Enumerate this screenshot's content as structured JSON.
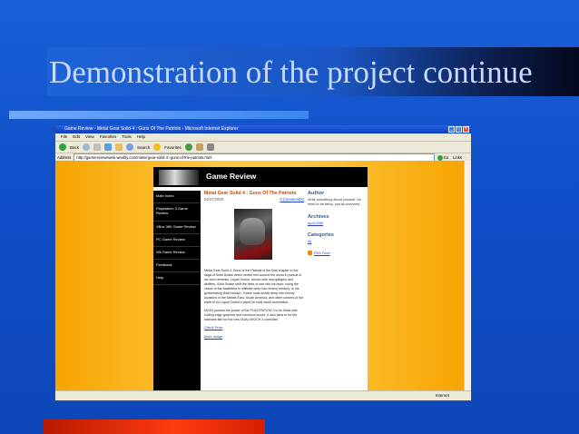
{
  "slide": {
    "title": "Demonstration of the project continue"
  },
  "browser": {
    "window_title": "Game Review - Metal Gear Solid 4 : Guns Of The Patriots - Microsoft Internet Explorer",
    "menu": [
      "File",
      "Edit",
      "View",
      "Favorites",
      "Tools",
      "Help"
    ],
    "toolbar": {
      "back": "Back",
      "search": "Search",
      "favorites": "Favorites"
    },
    "address_label": "Address",
    "address_value": "http://gamereviewsweb.weebly.com/metal-gear-solid-4--guns-of-the-patriots.html",
    "go_label": "Go",
    "links_label": "Links",
    "status_zone": "Internet"
  },
  "site": {
    "header_title": "Game Review",
    "nav": [
      "Main Index",
      "Playstation 3 Game Review",
      "XBox 360 Game Review",
      "PC Game Review",
      "Wii Game Review",
      "Feedback",
      "Help"
    ],
    "post": {
      "title": "Metal Gear Solid 4 : Guns Of The Patriots",
      "date": "04/27/2009",
      "comments": "0 Comment(s)",
      "body1": "Metal Gear Solid 4: Guns of the Patriots is the final chapter in the saga of Solid Snake which centre him around the world in pursuit of his arch nemesis, Liquid Ocelot. Armed with new gadgets and abilities, Solid Snake shift the tides of war into his favor, using the chaos of the battlefield to infiltrate deep into enemy territory. In his globetrotting final mission, Snake must sneak deep into enemy locations in the Middle East, South America, and other corners of the earth to rid Liquid Ocelot's plans for total world domination.",
      "body2": "MGS4 pushes the power of the PLAYSTATION 3 to its limits with cutting edge graphics and surround sound. It also aims to be the hallmark title for the new DUALSHOCK 3 controller.",
      "link1": "Check Price",
      "link2": "More Image"
    },
    "sidebar": {
      "author_heading": "Author",
      "author_text": "Write something about yourself. No need to be fancy, just an overview.",
      "archives_heading": "Archives",
      "archive_item": "April 2009",
      "categories_heading": "Categories",
      "category_item": "All",
      "rss": "RSS Feed"
    }
  }
}
